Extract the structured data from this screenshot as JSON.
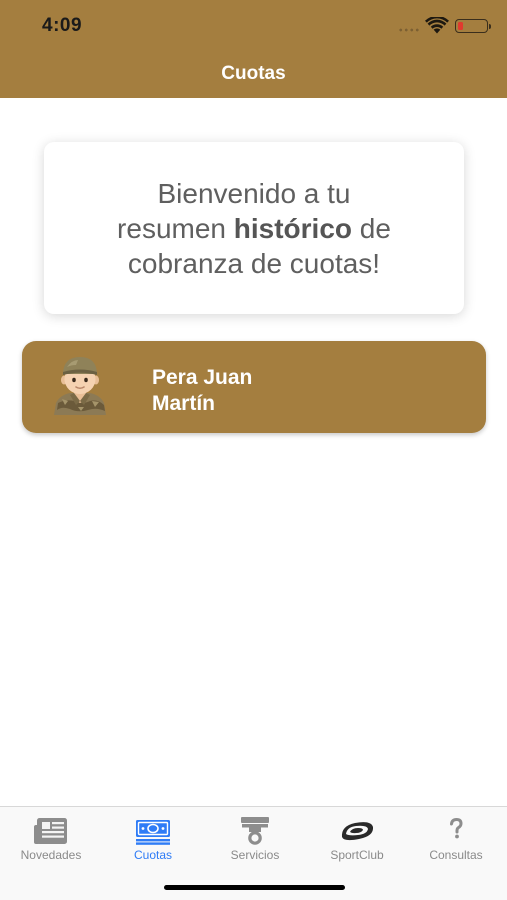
{
  "status": {
    "time": "4:09"
  },
  "header": {
    "title": "Cuotas"
  },
  "welcome": {
    "line1": "Bienvenido a tu",
    "line2_before": "resumen ",
    "line2_bold": "histórico",
    "line2_after": " de",
    "line3": "cobranza de cuotas!"
  },
  "member": {
    "first_line": "Pera Juan",
    "second_line": "Martín",
    "avatar_icon": "soldier-avatar-icon"
  },
  "tabs": [
    {
      "label": "Novedades",
      "icon": "newspaper-icon",
      "active": false
    },
    {
      "label": "Cuotas",
      "icon": "banknote-icon",
      "active": true
    },
    {
      "label": "Servicios",
      "icon": "medal-icon",
      "active": false
    },
    {
      "label": "SportClub",
      "icon": "sportclub-logo-icon",
      "active": false
    },
    {
      "label": "Consultas",
      "icon": "question-icon",
      "active": false
    }
  ],
  "colors": {
    "brand": "#a47e3f",
    "active_tab": "#2f7cf6",
    "inactive_tab": "#8a8a8a",
    "battery_low": "#e03a2e"
  }
}
